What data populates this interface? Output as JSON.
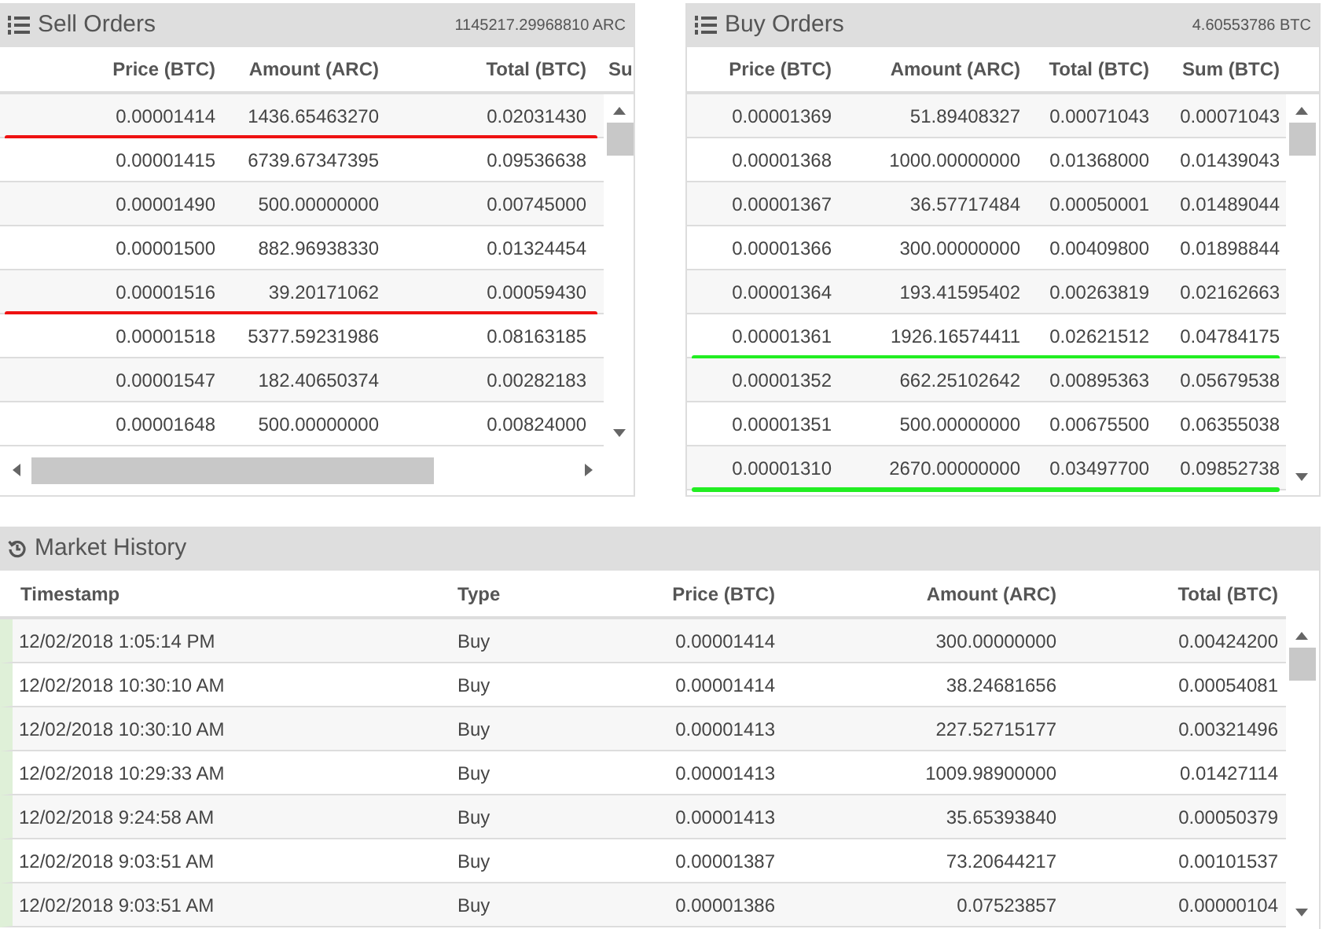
{
  "sell_orders": {
    "kind": "sell",
    "title": "Sell Orders",
    "total": "1145217.29968810 ARC",
    "columns": [
      "Price (BTC)",
      "Amount (ARC)",
      "Total (BTC)",
      "Su"
    ],
    "rows": [
      {
        "cells": [
          "0.00001414",
          "1436.65463270",
          "0.02031430"
        ],
        "underlined": true
      },
      {
        "cells": [
          "0.00001415",
          "6739.67347395",
          "0.09536638"
        ],
        "underlined": false
      },
      {
        "cells": [
          "0.00001490",
          "500.00000000",
          "0.00745000"
        ],
        "underlined": false
      },
      {
        "cells": [
          "0.00001500",
          "882.96938330",
          "0.01324454"
        ],
        "underlined": false
      },
      {
        "cells": [
          "0.00001516",
          "39.20171062",
          "0.00059430"
        ],
        "underlined": true
      },
      {
        "cells": [
          "0.00001518",
          "5377.59231986",
          "0.08163185"
        ],
        "underlined": false
      },
      {
        "cells": [
          "0.00001547",
          "182.40650374",
          "0.00282183"
        ],
        "underlined": false
      },
      {
        "cells": [
          "0.00001648",
          "500.00000000",
          "0.00824000"
        ],
        "underlined": false
      }
    ]
  },
  "buy_orders": {
    "kind": "buy",
    "title": "Buy Orders",
    "total": "4.60553786 BTC",
    "columns": [
      "Price (BTC)",
      "Amount (ARC)",
      "Total (BTC)",
      "Sum (BTC)"
    ],
    "rows": [
      {
        "cells": [
          "0.00001369",
          "51.89408327",
          "0.00071043",
          "0.00071043"
        ],
        "underlined": false
      },
      {
        "cells": [
          "0.00001368",
          "1000.00000000",
          "0.01368000",
          "0.01439043"
        ],
        "underlined": false
      },
      {
        "cells": [
          "0.00001367",
          "36.57717484",
          "0.00050001",
          "0.01489044"
        ],
        "underlined": false
      },
      {
        "cells": [
          "0.00001366",
          "300.00000000",
          "0.00409800",
          "0.01898844"
        ],
        "underlined": false
      },
      {
        "cells": [
          "0.00001364",
          "193.41595402",
          "0.00263819",
          "0.02162663"
        ],
        "underlined": false
      },
      {
        "cells": [
          "0.00001361",
          "1926.16574411",
          "0.02621512",
          "0.04784175"
        ],
        "underlined": true
      },
      {
        "cells": [
          "0.00001352",
          "662.25102642",
          "0.00895363",
          "0.05679538"
        ],
        "underlined": false
      },
      {
        "cells": [
          "0.00001351",
          "500.00000000",
          "0.00675500",
          "0.06355038"
        ],
        "underlined": false
      },
      {
        "cells": [
          "0.00001310",
          "2670.00000000",
          "0.03497700",
          "0.09852738"
        ],
        "underlined": true
      }
    ]
  },
  "market_history": {
    "title": "Market History",
    "columns": [
      "Timestamp",
      "Type",
      "Price (BTC)",
      "Amount (ARC)",
      "Total (BTC)"
    ],
    "rows": [
      [
        "12/02/2018 1:05:14 PM",
        "Buy",
        "0.00001414",
        "300.00000000",
        "0.00424200"
      ],
      [
        "12/02/2018 10:30:10 AM",
        "Buy",
        "0.00001414",
        "38.24681656",
        "0.00054081"
      ],
      [
        "12/02/2018 10:30:10 AM",
        "Buy",
        "0.00001413",
        "227.52715177",
        "0.00321496"
      ],
      [
        "12/02/2018 10:29:33 AM",
        "Buy",
        "0.00001413",
        "1009.98900000",
        "0.01427114"
      ],
      [
        "12/02/2018 9:24:58 AM",
        "Buy",
        "0.00001413",
        "35.65393840",
        "0.00050379"
      ],
      [
        "12/02/2018 9:03:51 AM",
        "Buy",
        "0.00001387",
        "73.20644217",
        "0.00101537"
      ],
      [
        "12/02/2018 9:03:51 AM",
        "Buy",
        "0.00001386",
        "0.07523857",
        "0.00000104"
      ]
    ]
  }
}
